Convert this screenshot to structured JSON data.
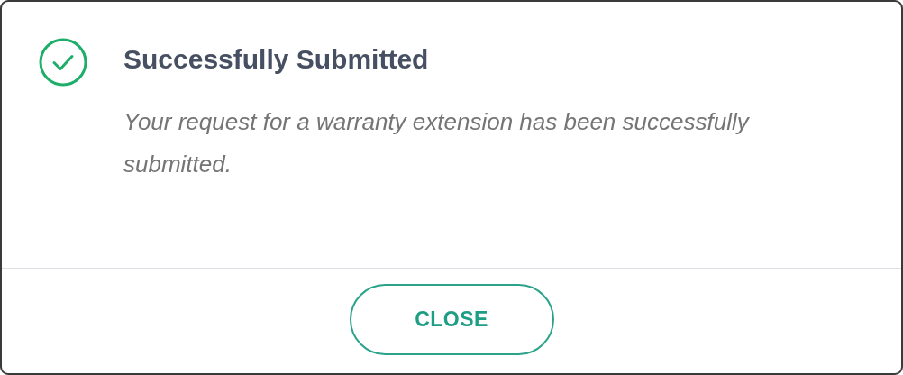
{
  "dialog": {
    "title": "Successfully Submitted",
    "message": "Your request for a warranty extension has been successfully submitted.",
    "buttons": [
      {
        "label": "CLOSE"
      }
    ]
  }
}
